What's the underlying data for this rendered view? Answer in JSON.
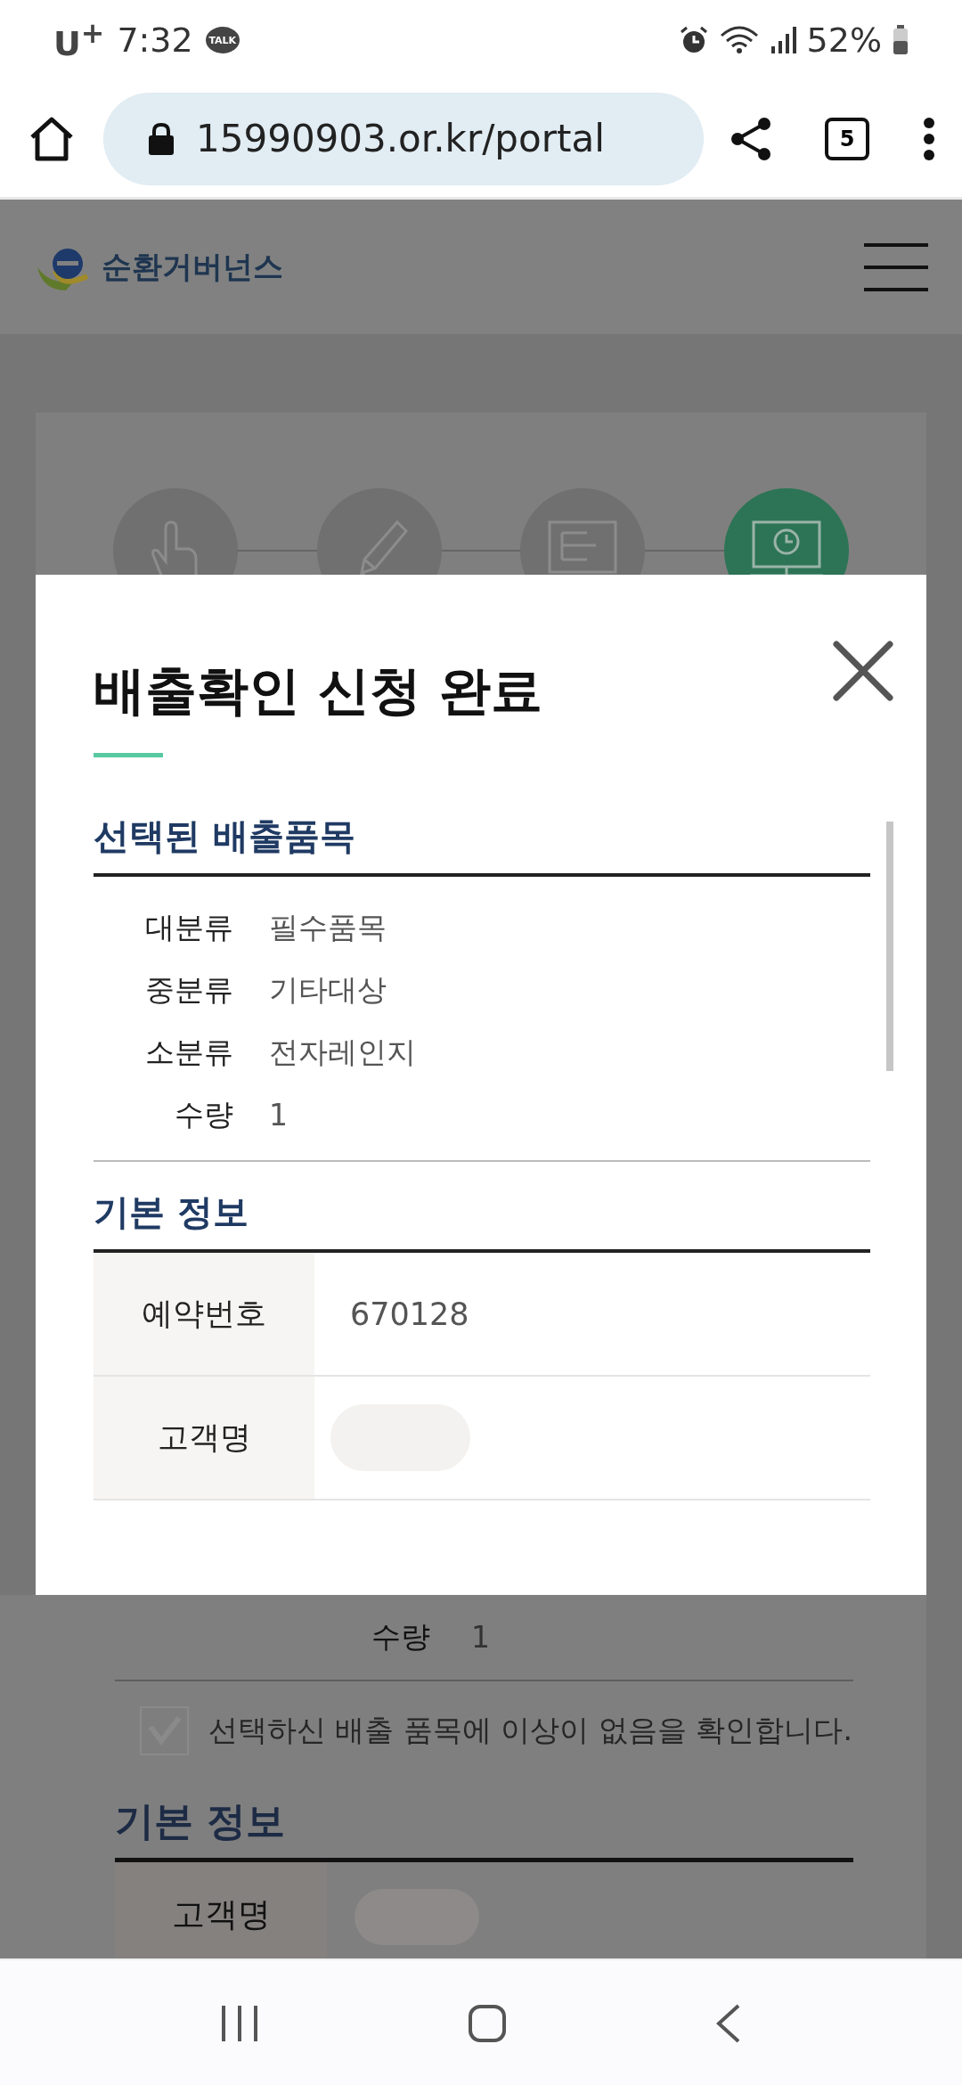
{
  "status_bar": {
    "carrier": "U$^{+}$",
    "time": "7:32",
    "notification": "TALK",
    "battery": "52%"
  },
  "browser": {
    "url": "15990903.or.kr/portal",
    "tab_count": "5"
  },
  "site_header": {
    "logo_text": "순환거버넌스"
  },
  "steps": [
    {
      "selected": false
    },
    {
      "selected": false
    },
    {
      "selected": false
    },
    {
      "selected": true
    }
  ],
  "modal": {
    "title": "배출확인 신청 완료",
    "item_section": {
      "title": "선택된 배출품목",
      "fields": [
        {
          "label": "대분류",
          "value": "필수품목"
        },
        {
          "label": "중분류",
          "value": "기타대상"
        },
        {
          "label": "소분류",
          "value": "전자레인지"
        },
        {
          "label": "수량",
          "value": "1"
        }
      ]
    },
    "info_section": {
      "title": "기본 정보",
      "rows": [
        {
          "kind": "text",
          "label": "예약번호",
          "value": "670128"
        },
        {
          "kind": "blurred",
          "label": "고객명"
        }
      ]
    }
  },
  "background": {
    "quantity": {
      "label": "수량",
      "value": "1"
    },
    "confirm": {
      "label": "선택하신 배출 품목에 이상이 없음을 확인합니다.",
      "checked": true
    },
    "info_title": "기본 정보",
    "rows": [
      {
        "kind": "blurred",
        "label": "고객명"
      }
    ]
  }
}
